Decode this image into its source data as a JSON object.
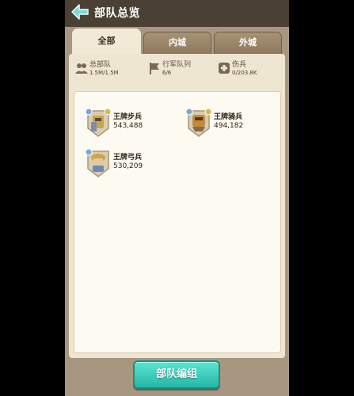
{
  "header": {
    "title": "部队总览",
    "back_icon": "back-arrow-icon"
  },
  "tabs": [
    {
      "label": "全部",
      "active": true
    },
    {
      "label": "内城",
      "active": false
    },
    {
      "label": "外城",
      "active": false
    }
  ],
  "stats": [
    {
      "icon": "troops-icon",
      "label": "总部队",
      "value": "1.5M/1.5M"
    },
    {
      "icon": "march-flag-icon",
      "label": "行军队列",
      "value": "6/6"
    },
    {
      "icon": "wounded-cross-icon",
      "label": "伤兵",
      "value": "0/203.8K"
    }
  ],
  "troops": [
    {
      "name": "王牌步兵",
      "count": "543,488",
      "icon": "infantry-portrait-icon"
    },
    {
      "name": "王牌骑兵",
      "count": "494,182",
      "icon": "cavalry-portrait-icon"
    },
    {
      "name": "王牌弓兵",
      "count": "530,209",
      "icon": "archer-portrait-icon"
    }
  ],
  "footer": {
    "button_label": "部队编组"
  },
  "colors": {
    "accent": "#38c9b8",
    "panel": "#efe6d1",
    "header": "#4a4034"
  }
}
